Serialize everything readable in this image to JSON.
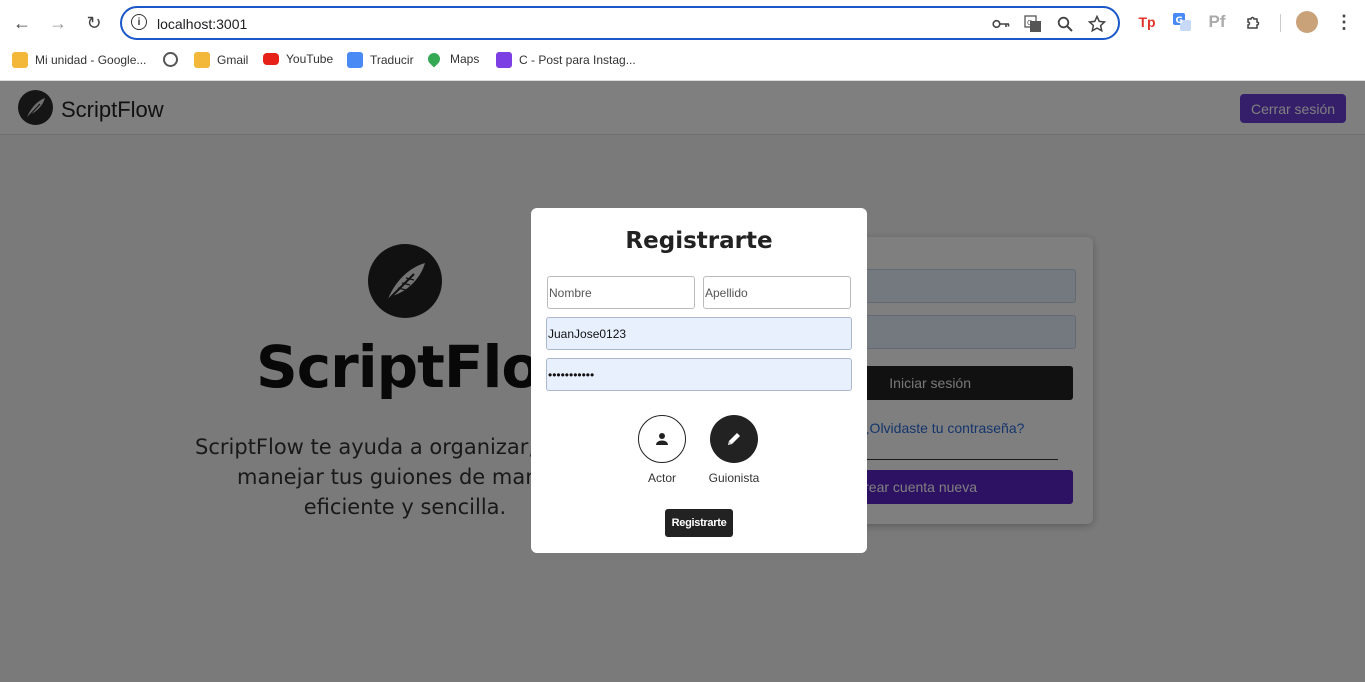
{
  "browser": {
    "url": "localhost:3001",
    "bookmarks": [
      {
        "label": "Mi unidad - Google...",
        "icon": "drive-icon"
      },
      {
        "label": "",
        "icon": "globe-icon"
      },
      {
        "label": "Gmail",
        "icon": "drive-icon"
      },
      {
        "label": "YouTube",
        "icon": "youtube-icon"
      },
      {
        "label": "Traducir",
        "icon": "translate-icon"
      },
      {
        "label": "Maps",
        "icon": "maps-icon"
      },
      {
        "label": "C - Post para Instag...",
        "icon": "heart-chat-icon"
      }
    ],
    "extensions": {
      "tp": "Tp",
      "pf": "Pf"
    }
  },
  "app": {
    "brand": "ScriptFlow",
    "logout_label": "Cerrar sesión",
    "hero_title": "ScriptFlow",
    "hero_desc_lines": [
      "ScriptFlow te ayuda a organizar, crear y",
      "manejar tus guiones de manera",
      "eficiente y sencilla."
    ],
    "login": {
      "login_label": "Iniciar sesión",
      "forgot_label": "¿Olvidaste tu contraseña?",
      "create_label": "Crear cuenta nueva"
    }
  },
  "modal": {
    "title": "Registrarte",
    "first_name_placeholder": "Nombre",
    "last_name_placeholder": "Apellido",
    "username_value": "JuanJose0123",
    "password_value": "•••••••••••",
    "roles": [
      "Actor",
      "Guionista"
    ],
    "submit_label": "Registrarte"
  },
  "colors": {
    "accent": "#6b3fd4",
    "create": "#5b22c7",
    "omnibox_border": "#1a57c9"
  }
}
